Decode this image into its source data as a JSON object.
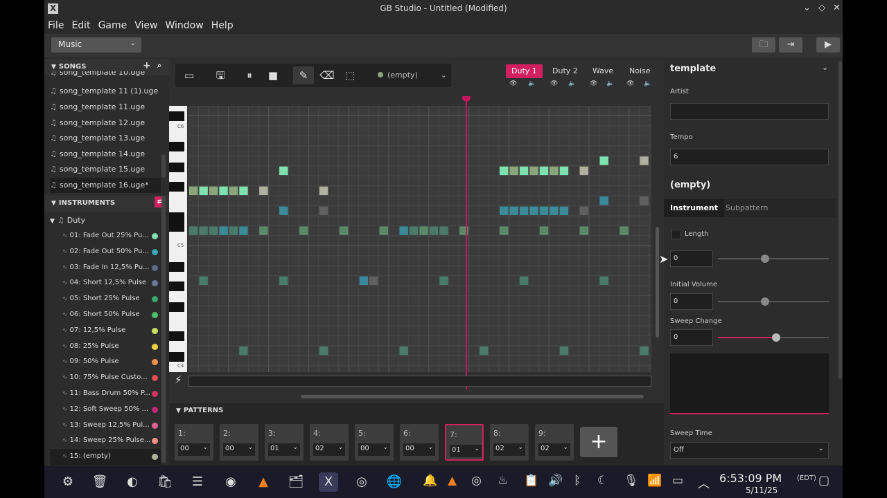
{
  "window": {
    "title": "GB Studio - Untitled (Modified)"
  },
  "menu": [
    "File",
    "Edit",
    "Game",
    "View",
    "Window",
    "Help"
  ],
  "section_select": "Music",
  "songs": {
    "header": "SONGS",
    "items": [
      "song_template 10.uge",
      "song_template 11 (1).uge",
      "song_template 11.uge",
      "song_template 12.uge",
      "song_template 13.uge",
      "song_template 14.uge",
      "song_template 15.uge",
      "song_template 16.uge*"
    ]
  },
  "instruments": {
    "header": "INSTRUMENTS",
    "group": "Duty",
    "items": [
      {
        "label": "01: Fade Out 25% Pu...",
        "color": "#7fe0b0"
      },
      {
        "label": "02: Fade Out 50% Pu...",
        "color": "#3aa7b8"
      },
      {
        "label": "03: Fade In 12,5% Pu...",
        "color": "#5a6a8a"
      },
      {
        "label": "04: Short 12,5% Pulse",
        "color": "#6a7a9a"
      },
      {
        "label": "05: Short 25% Pulse",
        "color": "#3aa86a"
      },
      {
        "label": "06: Short 50% Pulse",
        "color": "#4ec26a"
      },
      {
        "label": "07: 12,5% Pulse",
        "color": "#c8e060"
      },
      {
        "label": "08: 25% Pulse",
        "color": "#f0d040"
      },
      {
        "label": "09: 50% Pulse",
        "color": "#f09050"
      },
      {
        "label": "10: 75% Pulse Custo...",
        "color": "#e05050"
      },
      {
        "label": "11: Bass Drum 50% P...",
        "color": "#d03060"
      },
      {
        "label": "12: Soft Sweep 50% ...",
        "color": "#c02878"
      },
      {
        "label": "13: Sweep 12,5% Pul...",
        "color": "#e06090"
      },
      {
        "label": "14: Sweep 25% Pulse...",
        "color": "#f09080"
      },
      {
        "label": "15: (empty)",
        "color": "#b0b0a0"
      }
    ]
  },
  "editor": {
    "instrument_select": "(empty)",
    "channels": [
      "Duty 1",
      "Duty 2",
      "Wave",
      "Noise"
    ],
    "octave_labels": [
      "C6",
      "C5",
      "C4"
    ]
  },
  "patterns": {
    "header": "PATTERNS",
    "items": [
      {
        "num": "1:",
        "val": "00"
      },
      {
        "num": "2:",
        "val": "00"
      },
      {
        "num": "3:",
        "val": "01"
      },
      {
        "num": "4:",
        "val": "02"
      },
      {
        "num": "5:",
        "val": "00"
      },
      {
        "num": "6:",
        "val": "00"
      },
      {
        "num": "7:",
        "val": "01"
      },
      {
        "num": "8:",
        "val": "02"
      },
      {
        "num": "9:",
        "val": "02"
      }
    ],
    "add_label": "+"
  },
  "right": {
    "song_name": "template",
    "artist_label": "Artist",
    "artist_value": "",
    "tempo_label": "Tempo",
    "tempo_value": "6",
    "instrument_name": "(empty)",
    "tab_instrument": "Instrument",
    "tab_subpattern": "Subpattern",
    "length_label": "Length",
    "length_value": "0",
    "initial_volume_label": "Initial Volume",
    "initial_volume_value": "0",
    "sweep_change_label": "Sweep Change",
    "sweep_change_value": "0",
    "sweep_time_label": "Sweep Time",
    "sweep_time_value": "Off",
    "accent": "#d0215e"
  },
  "taskbar": {
    "time": "6:53:09 PM",
    "tz": "(EDT)",
    "date": "5/11/25"
  }
}
